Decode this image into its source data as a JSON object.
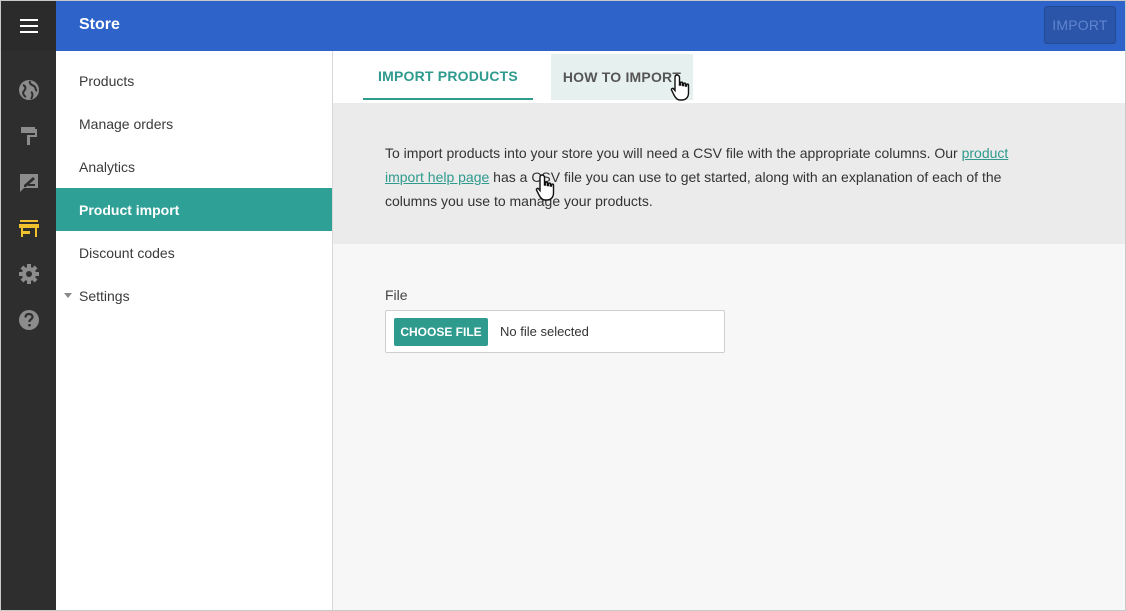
{
  "header": {
    "title": "Store",
    "import_label": "IMPORT",
    "menu_icon": "hamburger-menu-icon"
  },
  "rail": {
    "icons": [
      "globe-icon",
      "paint-roller-icon",
      "edit-image-icon",
      "store-icon",
      "gear-icon",
      "help-icon"
    ],
    "active_icon": "store-icon",
    "active_color": "#f2c12e"
  },
  "sidebar": {
    "items": [
      {
        "label": "Products"
      },
      {
        "label": "Manage orders"
      },
      {
        "label": "Analytics"
      },
      {
        "label": "Product import"
      },
      {
        "label": "Discount codes"
      },
      {
        "label": "Settings"
      }
    ],
    "active": "Product import"
  },
  "tabs": [
    {
      "label": "IMPORT PRODUCTS"
    },
    {
      "label": "HOW TO IMPORT"
    }
  ],
  "info": {
    "text_before": "To import products into your store you will need a CSV file with the appropriate columns. Our ",
    "link_text": "product import help page",
    "text_after": " has a CSV file you can use to get started, along with an explanation of each of the columns you use to manage your products."
  },
  "file": {
    "label": "File",
    "button_label": "CHOOSE FILE",
    "status": "No file selected"
  },
  "colors": {
    "topbar": "#2e63c9",
    "accent": "#2f9a8e",
    "rail": "#2e2e2e"
  }
}
